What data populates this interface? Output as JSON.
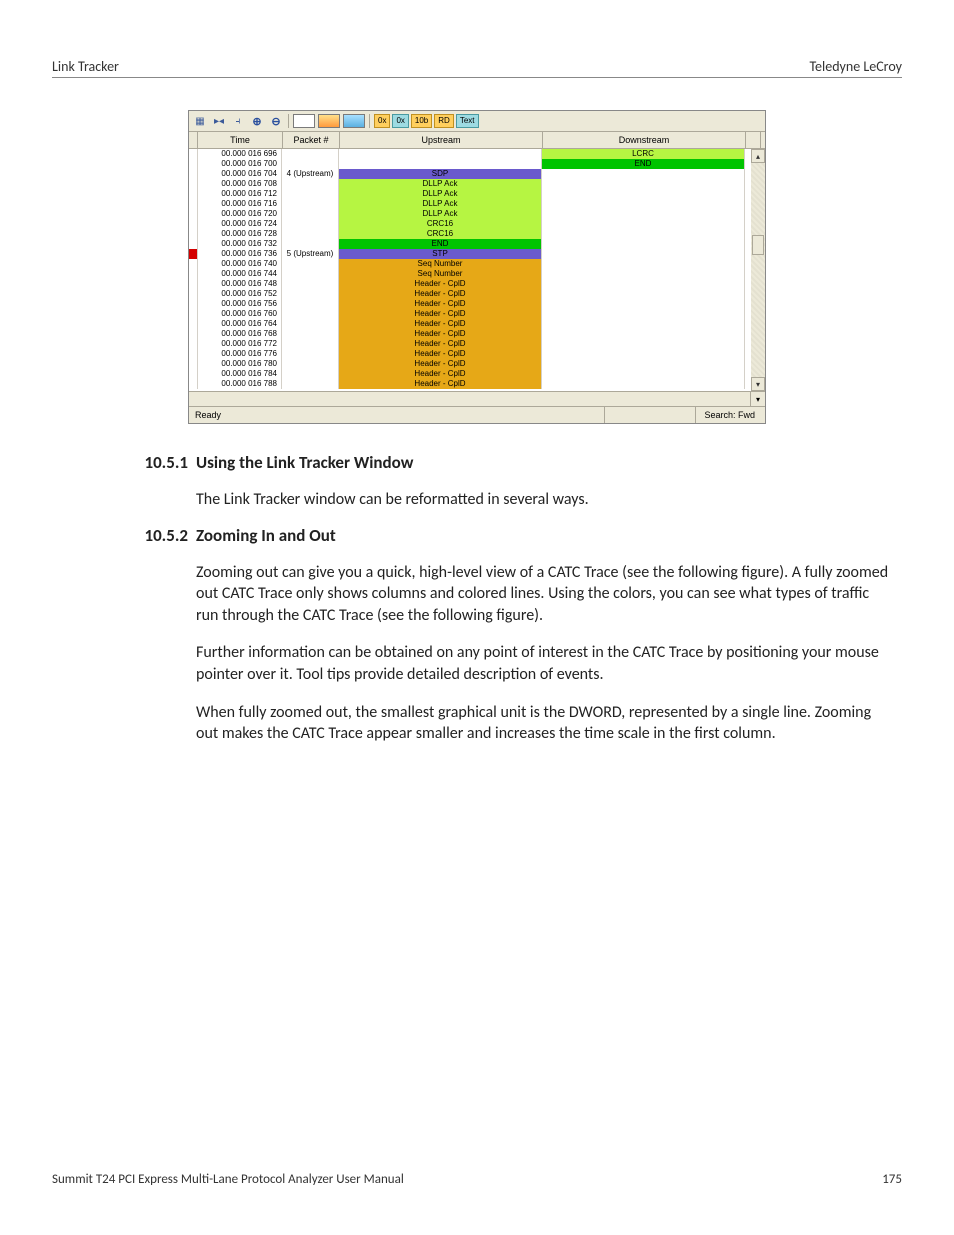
{
  "header": {
    "left": "Link Tracker",
    "right": "Teledyne LeCroy"
  },
  "footer": {
    "left": "Summit T24 PCI Express Multi-Lane Protocol Analyzer User Manual",
    "right": "175"
  },
  "sections": {
    "s1": {
      "num": "10.5.1",
      "title": "Using the Link Tracker Window",
      "p1": "The Link Tracker window can be reformatted in several ways."
    },
    "s2": {
      "num": "10.5.2",
      "title": "Zooming In and Out",
      "p1": "Zooming out can give you a quick, high-level view of a CATC Trace (see the following figure). A fully zoomed out CATC Trace only shows columns and colored lines. Using the colors, you can see what types of traffic run through the CATC Trace (see the following figure).",
      "p2": "Further information can be obtained on any point of interest in the CATC Trace by positioning your mouse pointer over it. Tool tips provide detailed description of events.",
      "p3": "When fully zoomed out, the smallest graphical unit is the DWORD, represented by a single line. Zooming out makes the CATC Trace appear smaller and increases the time scale in the first column."
    }
  },
  "screenshot": {
    "toolbar": {
      "btn_label_ox1": "0x",
      "btn_label_ox2": "0x",
      "btn_label_10b": "10b",
      "btn_label_rd": "RD",
      "btn_label_text": "Text"
    },
    "headers": {
      "time": "Time",
      "packet": "Packet #",
      "upstream": "Upstream",
      "downstream": "Downstream"
    },
    "status": {
      "ready": "Ready",
      "search": "Search: Fwd"
    },
    "rows": [
      {
        "time": "00.000 016 696",
        "pkt": "",
        "up": "",
        "dn": "LCRC",
        "up_bg": "",
        "dn_bg": "bg-lime"
      },
      {
        "time": "00.000 016 700",
        "pkt": "",
        "up": "",
        "dn": "END",
        "up_bg": "",
        "dn_bg": "bg-green"
      },
      {
        "time": "00.000 016 704",
        "pkt": "4 (Upstream)",
        "up": "SDP",
        "dn": "",
        "up_bg": "bg-purple",
        "dn_bg": ""
      },
      {
        "time": "00.000 016 708",
        "pkt": "",
        "up": "DLLP Ack",
        "dn": "",
        "up_bg": "bg-lime",
        "dn_bg": ""
      },
      {
        "time": "00.000 016 712",
        "pkt": "",
        "up": "DLLP Ack",
        "dn": "",
        "up_bg": "bg-lime",
        "dn_bg": ""
      },
      {
        "time": "00.000 016 716",
        "pkt": "",
        "up": "DLLP Ack",
        "dn": "",
        "up_bg": "bg-lime",
        "dn_bg": ""
      },
      {
        "time": "00.000 016 720",
        "pkt": "",
        "up": "DLLP Ack",
        "dn": "",
        "up_bg": "bg-lime",
        "dn_bg": ""
      },
      {
        "time": "00.000 016 724",
        "pkt": "",
        "up": "CRC16",
        "dn": "",
        "up_bg": "bg-lime",
        "dn_bg": ""
      },
      {
        "time": "00.000 016 728",
        "pkt": "",
        "up": "CRC16",
        "dn": "",
        "up_bg": "bg-lime",
        "dn_bg": ""
      },
      {
        "time": "00.000 016 732",
        "pkt": "",
        "up": "END",
        "dn": "",
        "up_bg": "bg-green",
        "dn_bg": ""
      },
      {
        "time": "00.000 016 736",
        "pkt": "5 (Upstream)",
        "up": "STP",
        "dn": "",
        "up_bg": "bg-purple",
        "dn_bg": "",
        "mark": true
      },
      {
        "time": "00.000 016 740",
        "pkt": "",
        "up": "Seq Number",
        "dn": "",
        "up_bg": "bg-orange",
        "dn_bg": ""
      },
      {
        "time": "00.000 016 744",
        "pkt": "",
        "up": "Seq Number",
        "dn": "",
        "up_bg": "bg-orange",
        "dn_bg": ""
      },
      {
        "time": "00.000 016 748",
        "pkt": "",
        "up": "Header - CplD",
        "dn": "",
        "up_bg": "bg-orange",
        "dn_bg": ""
      },
      {
        "time": "00.000 016 752",
        "pkt": "",
        "up": "Header - CplD",
        "dn": "",
        "up_bg": "bg-orange",
        "dn_bg": ""
      },
      {
        "time": "00.000 016 756",
        "pkt": "",
        "up": "Header - CplD",
        "dn": "",
        "up_bg": "bg-orange",
        "dn_bg": ""
      },
      {
        "time": "00.000 016 760",
        "pkt": "",
        "up": "Header - CplD",
        "dn": "",
        "up_bg": "bg-orange",
        "dn_bg": ""
      },
      {
        "time": "00.000 016 764",
        "pkt": "",
        "up": "Header - CplD",
        "dn": "",
        "up_bg": "bg-orange",
        "dn_bg": ""
      },
      {
        "time": "00.000 016 768",
        "pkt": "",
        "up": "Header - CplD",
        "dn": "",
        "up_bg": "bg-orange",
        "dn_bg": ""
      },
      {
        "time": "00.000 016 772",
        "pkt": "",
        "up": "Header - CplD",
        "dn": "",
        "up_bg": "bg-orange",
        "dn_bg": ""
      },
      {
        "time": "00.000 016 776",
        "pkt": "",
        "up": "Header - CplD",
        "dn": "",
        "up_bg": "bg-orange",
        "dn_bg": ""
      },
      {
        "time": "00.000 016 780",
        "pkt": "",
        "up": "Header - CplD",
        "dn": "",
        "up_bg": "bg-orange",
        "dn_bg": ""
      },
      {
        "time": "00.000 016 784",
        "pkt": "",
        "up": "Header - CplD",
        "dn": "",
        "up_bg": "bg-orange",
        "dn_bg": ""
      },
      {
        "time": "00.000 016 788",
        "pkt": "",
        "up": "Header - CplD",
        "dn": "",
        "up_bg": "bg-orange",
        "dn_bg": ""
      }
    ]
  }
}
